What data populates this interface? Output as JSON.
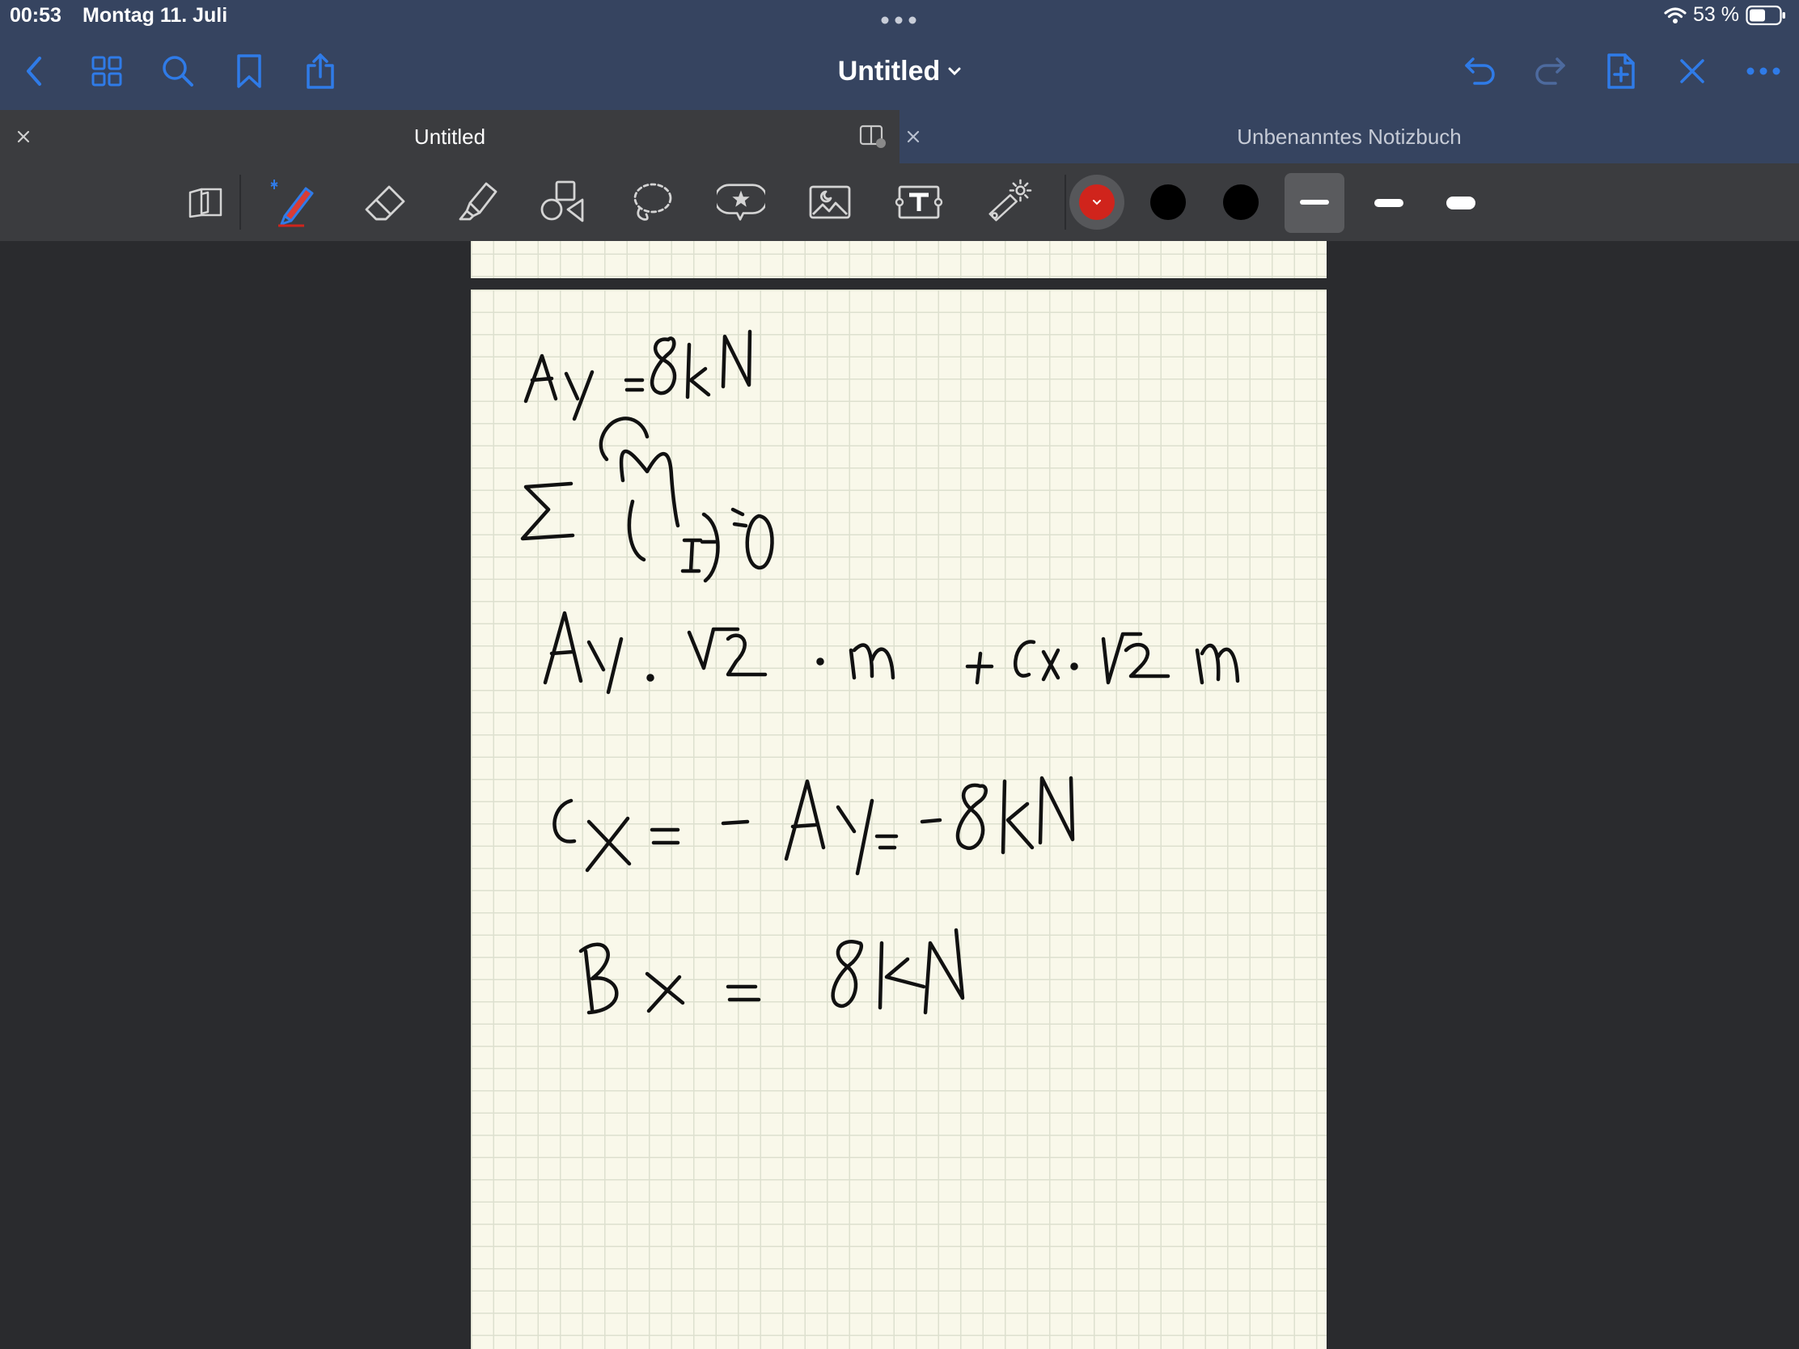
{
  "status": {
    "time": "00:53",
    "date": "Montag 11. Juli",
    "battery": "53 %"
  },
  "navbar": {
    "title": "Untitled",
    "left_icons": [
      "back-chevron-icon",
      "grid-icon",
      "search-icon",
      "bookmark-icon",
      "share-icon"
    ],
    "right_icons": [
      "undo-icon",
      "redo-icon",
      "add-page-icon",
      "close-x-icon",
      "more-icon"
    ]
  },
  "tabs": [
    {
      "label": "Untitled",
      "active": true
    },
    {
      "label": "Unbenanntes Notizbuch",
      "active": false
    }
  ],
  "toolbar": {
    "tools": [
      "read-only-icon",
      "pen-icon",
      "eraser-icon",
      "highlighter-icon",
      "shapes-icon",
      "lasso-icon",
      "sticker-icon",
      "image-icon",
      "text-icon",
      "laser-pointer-icon"
    ],
    "selected_tool": "pen-icon",
    "colors": [
      "#d0241c",
      "#000000",
      "#000000"
    ],
    "stroke_widths": [
      "thin",
      "medium",
      "thick"
    ]
  },
  "accent_color": "#2f7be8",
  "note_lines": [
    "Ay = 8kN",
    "Σ M(I) = 0",
    "Ay · √2 · m + Cx · √2 m",
    "Cx = - Ay = - 8kN",
    "Bx = 8kN"
  ]
}
